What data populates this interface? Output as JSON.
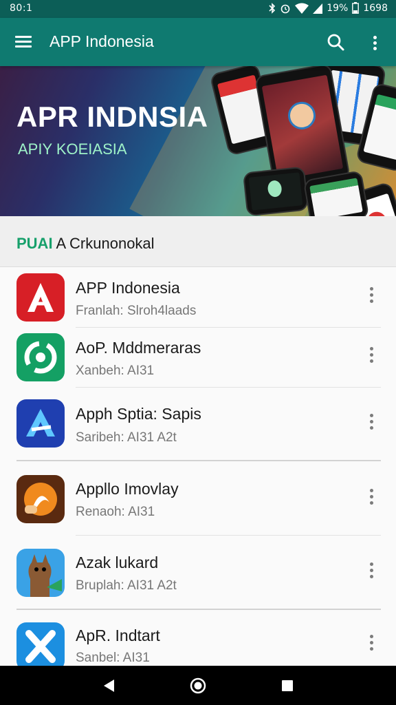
{
  "status_bar": {
    "time": "80:1",
    "battery": "19%",
    "clock_right": "1698"
  },
  "app_bar": {
    "title": "APP Indonesia",
    "menu_icon": "hamburger-menu-icon",
    "search_icon": "search-icon",
    "more_icon": "more-vertical-icon"
  },
  "banner": {
    "title": "APR INDNSIA",
    "subtitle": "APIY KOEIASIA"
  },
  "section": {
    "title_accent": "PUAI",
    "title_rest": " A Crkunonokal"
  },
  "apps": [
    {
      "name": "APP Indonesia",
      "subtitle": "Franlah: Slroh4laads",
      "icon": "red-a-logo-icon",
      "color": "#d71f26"
    },
    {
      "name": "AoP. Mddmeraras",
      "subtitle": "Xanbeh: AI31",
      "icon": "green-ring-logo-icon",
      "color": "#14a064"
    },
    {
      "name": "Apph Sptia: Sapis",
      "subtitle": "Saribeh: AI31   A2t",
      "icon": "blue-a-logo-icon",
      "color": "#1f3fb0"
    },
    {
      "name": "Appllo Imovlay",
      "subtitle": "Renaoh: AI31",
      "icon": "orange-fox-logo-icon",
      "color": "#5a2a10"
    },
    {
      "name": "Azak lukard",
      "subtitle": "Bruplah: AI31   A2t",
      "icon": "kangaroo-logo-icon",
      "color": "#3aa2e6"
    },
    {
      "name": "ApR. Indtart",
      "subtitle": "Sanbel: AI31",
      "icon": "blue-x-logo-icon",
      "color": "#1c8fe0"
    }
  ],
  "nav": {
    "back_icon": "back-triangle-icon",
    "home_icon": "home-circle-icon",
    "recents_icon": "recents-square-icon"
  }
}
